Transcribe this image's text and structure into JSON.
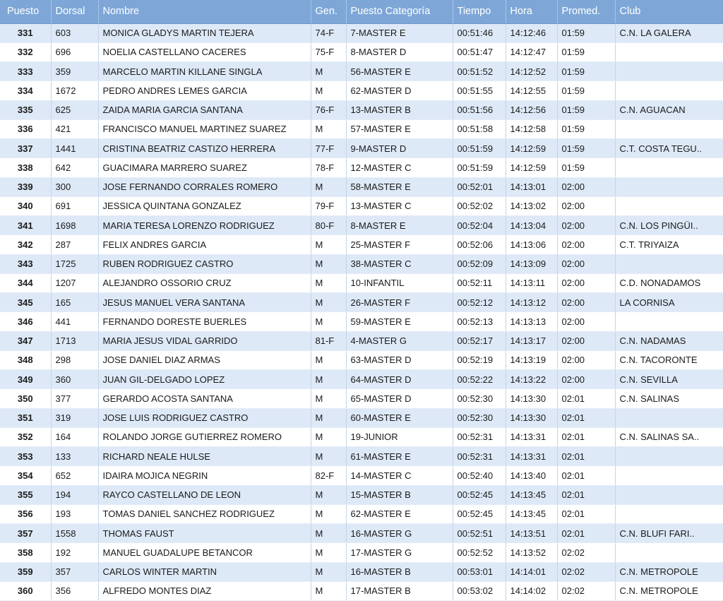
{
  "headers": [
    "Puesto",
    "Dorsal",
    "Nombre",
    "Gen.",
    "Puesto Categoría",
    "Tiempo",
    "Hora",
    "Promed.",
    "Club"
  ],
  "rows": [
    [
      "331",
      "603",
      "MONICA GLADYS MARTIN TEJERA",
      "74-F",
      "7-MASTER E",
      "00:51:46",
      "14:12:46",
      "01:59",
      "C.N. LA GALERA"
    ],
    [
      "332",
      "696",
      "NOELIA CASTELLANO CACERES",
      "75-F",
      "8-MASTER D",
      "00:51:47",
      "14:12:47",
      "01:59",
      ""
    ],
    [
      "333",
      "359",
      "MARCELO MARTIN KILLANE SINGLA",
      "M",
      "56-MASTER E",
      "00:51:52",
      "14:12:52",
      "01:59",
      ""
    ],
    [
      "334",
      "1672",
      "PEDRO ANDRES LEMES GARCIA",
      "M",
      "62-MASTER D",
      "00:51:55",
      "14:12:55",
      "01:59",
      ""
    ],
    [
      "335",
      "625",
      "ZAIDA MARIA GARCIA SANTANA",
      "76-F",
      "13-MASTER B",
      "00:51:56",
      "14:12:56",
      "01:59",
      "C.N. AGUACAN"
    ],
    [
      "336",
      "421",
      "FRANCISCO MANUEL MARTINEZ SUAREZ",
      "M",
      "57-MASTER E",
      "00:51:58",
      "14:12:58",
      "01:59",
      ""
    ],
    [
      "337",
      "1441",
      "CRISTINA BEATRIZ CASTIZO HERRERA",
      "77-F",
      "9-MASTER D",
      "00:51:59",
      "14:12:59",
      "01:59",
      "C.T. COSTA TEGU.."
    ],
    [
      "338",
      "642",
      "GUACIMARA MARRERO SUAREZ",
      "78-F",
      "12-MASTER C",
      "00:51:59",
      "14:12:59",
      "01:59",
      ""
    ],
    [
      "339",
      "300",
      "JOSE FERNANDO CORRALES ROMERO",
      "M",
      "58-MASTER E",
      "00:52:01",
      "14:13:01",
      "02:00",
      ""
    ],
    [
      "340",
      "691",
      "JESSICA QUINTANA GONZALEZ",
      "79-F",
      "13-MASTER C",
      "00:52:02",
      "14:13:02",
      "02:00",
      ""
    ],
    [
      "341",
      "1698",
      "MARIA TERESA LORENZO RODRIGUEZ",
      "80-F",
      "8-MASTER E",
      "00:52:04",
      "14:13:04",
      "02:00",
      "C.N. LOS PINGÜI.."
    ],
    [
      "342",
      "287",
      "FELIX ANDRES GARCIA",
      "M",
      "25-MASTER F",
      "00:52:06",
      "14:13:06",
      "02:00",
      "C.T. TRIYAIZA"
    ],
    [
      "343",
      "1725",
      "RUBEN RODRIGUEZ CASTRO",
      "M",
      "38-MASTER C",
      "00:52:09",
      "14:13:09",
      "02:00",
      ""
    ],
    [
      "344",
      "1207",
      "ALEJANDRO OSSORIO CRUZ",
      "M",
      "10-INFANTIL",
      "00:52:11",
      "14:13:11",
      "02:00",
      "C.D. NONADAMOS"
    ],
    [
      "345",
      "165",
      "JESUS MANUEL VERA SANTANA",
      "M",
      "26-MASTER F",
      "00:52:12",
      "14:13:12",
      "02:00",
      "LA CORNISA"
    ],
    [
      "346",
      "441",
      "FERNANDO DORESTE BUERLES",
      "M",
      "59-MASTER E",
      "00:52:13",
      "14:13:13",
      "02:00",
      ""
    ],
    [
      "347",
      "1713",
      "MARIA JESUS VIDAL GARRIDO",
      "81-F",
      "4-MASTER G",
      "00:52:17",
      "14:13:17",
      "02:00",
      "C.N. NADAMAS"
    ],
    [
      "348",
      "298",
      "JOSE DANIEL DIAZ ARMAS",
      "M",
      "63-MASTER D",
      "00:52:19",
      "14:13:19",
      "02:00",
      "C.N. TACORONTE"
    ],
    [
      "349",
      "360",
      "JUAN GIL-DELGADO LOPEZ",
      "M",
      "64-MASTER D",
      "00:52:22",
      "14:13:22",
      "02:00",
      "C.N. SEVILLA"
    ],
    [
      "350",
      "377",
      "GERARDO ACOSTA SANTANA",
      "M",
      "65-MASTER D",
      "00:52:30",
      "14:13:30",
      "02:01",
      "C.N. SALINAS"
    ],
    [
      "351",
      "319",
      "JOSE LUIS RODRIGUEZ CASTRO",
      "M",
      "60-MASTER E",
      "00:52:30",
      "14:13:30",
      "02:01",
      ""
    ],
    [
      "352",
      "164",
      "ROLANDO JORGE GUTIERREZ ROMERO",
      "M",
      "19-JUNIOR",
      "00:52:31",
      "14:13:31",
      "02:01",
      "C.N. SALINAS SA.."
    ],
    [
      "353",
      "133",
      "RICHARD NEALE HULSE",
      "M",
      "61-MASTER E",
      "00:52:31",
      "14:13:31",
      "02:01",
      ""
    ],
    [
      "354",
      "652",
      "IDAIRA MOJICA NEGRIN",
      "82-F",
      "14-MASTER C",
      "00:52:40",
      "14:13:40",
      "02:01",
      ""
    ],
    [
      "355",
      "194",
      "RAYCO CASTELLANO DE LEON",
      "M",
      "15-MASTER B",
      "00:52:45",
      "14:13:45",
      "02:01",
      ""
    ],
    [
      "356",
      "193",
      "TOMAS DANIEL SANCHEZ RODRIGUEZ",
      "M",
      "62-MASTER E",
      "00:52:45",
      "14:13:45",
      "02:01",
      ""
    ],
    [
      "357",
      "1558",
      "THOMAS FAUST",
      "M",
      "16-MASTER G",
      "00:52:51",
      "14:13:51",
      "02:01",
      "C.N. BLUFI FARI.."
    ],
    [
      "358",
      "192",
      "MANUEL GUADALUPE BETANCOR",
      "M",
      "17-MASTER G",
      "00:52:52",
      "14:13:52",
      "02:02",
      ""
    ],
    [
      "359",
      "357",
      "CARLOS WINTER MARTIN",
      "M",
      "16-MASTER B",
      "00:53:01",
      "14:14:01",
      "02:02",
      "C.N. METROPOLE"
    ],
    [
      "360",
      "356",
      "ALFREDO MONTES DIAZ",
      "M",
      "17-MASTER B",
      "00:53:02",
      "14:14:02",
      "02:02",
      "C.N. METROPOLE"
    ]
  ]
}
